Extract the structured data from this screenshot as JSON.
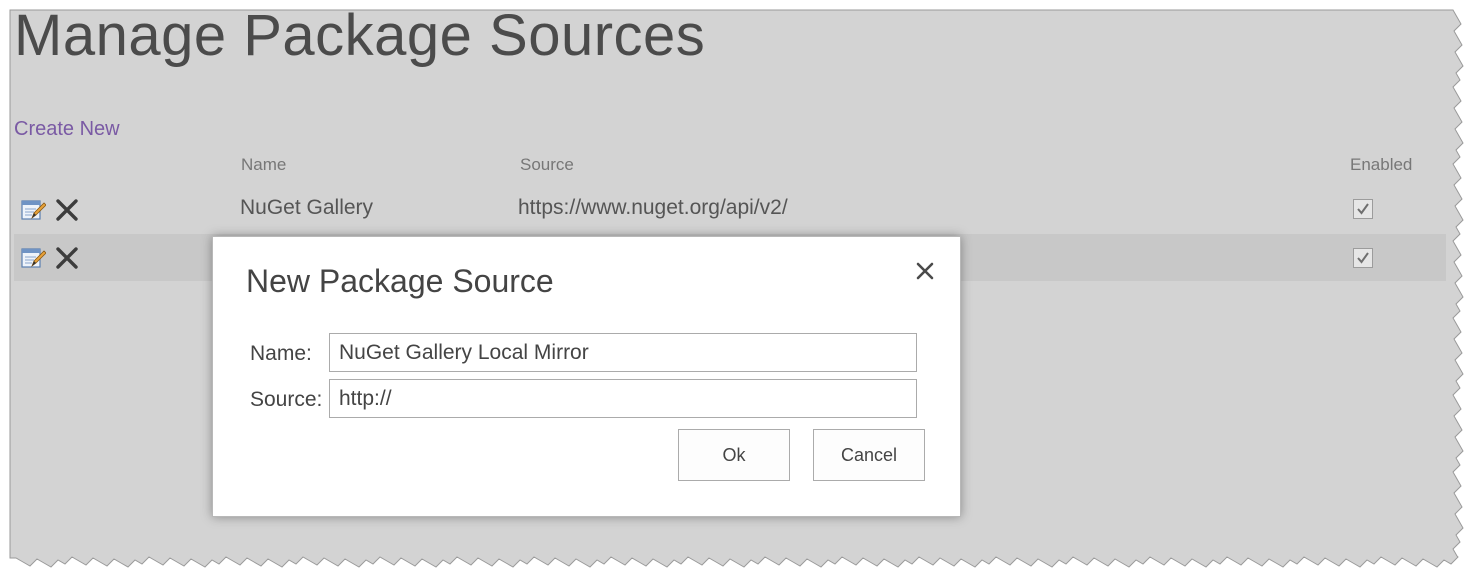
{
  "page": {
    "title": "Manage Package Sources",
    "create_new_label": "Create New"
  },
  "table": {
    "columns": {
      "name": "Name",
      "source": "Source",
      "enabled": "Enabled"
    },
    "rows": [
      {
        "name": "NuGet Gallery",
        "source": "https://www.nuget.org/api/v2/",
        "enabled": true
      },
      {
        "name": "",
        "source": "",
        "enabled": true
      }
    ],
    "action_icons": [
      "edit-icon",
      "delete-icon"
    ]
  },
  "dialog": {
    "title": "New Package Source",
    "name_label": "Name:",
    "name_value": "NuGet Gallery Local Mirror",
    "source_label": "Source:",
    "source_value": "http://",
    "ok_label": "Ok",
    "cancel_label": "Cancel",
    "close_icon": "close-icon"
  },
  "colors": {
    "page_background": "#d3d3d3",
    "link": "#7a5aa4",
    "row_highlight": "#c8c8c8"
  }
}
